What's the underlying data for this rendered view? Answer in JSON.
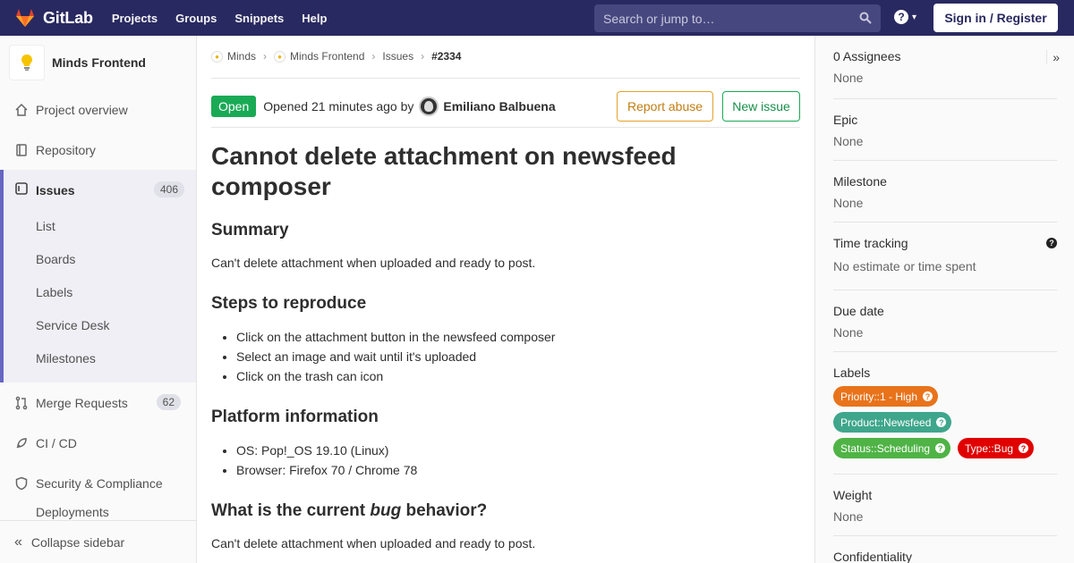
{
  "navbar": {
    "brand": "GitLab",
    "links": [
      "Projects",
      "Groups",
      "Snippets",
      "Help"
    ],
    "search_placeholder": "Search or jump to…",
    "signin_label": "Sign in / Register"
  },
  "sidebar": {
    "project_name": "Minds Frontend",
    "items": {
      "overview": "Project overview",
      "repository": "Repository",
      "issues": "Issues",
      "issues_count": "406",
      "merge_requests": "Merge Requests",
      "mr_count": "62",
      "cicd": "CI / CD",
      "security": "Security & Compliance",
      "deployments_partial": "Deployments"
    },
    "issues_sub": [
      "List",
      "Boards",
      "Labels",
      "Service Desk",
      "Milestones"
    ],
    "collapse_label": "Collapse sidebar"
  },
  "breadcrumb": {
    "group": "Minds",
    "project": "Minds Frontend",
    "section": "Issues",
    "current": "#2334"
  },
  "issue": {
    "status": "Open",
    "opened_text": "Opened 21 minutes ago by",
    "author": "Emiliano Balbuena",
    "report_label": "Report abuse",
    "new_issue_label": "New issue",
    "title": "Cannot delete attachment on newsfeed composer",
    "summary_heading": "Summary",
    "summary_text": "Can't delete attachment when uploaded and ready to post.",
    "steps_heading": "Steps to reproduce",
    "steps": [
      "Click on the attachment button in the newsfeed composer",
      "Select an image and wait until it's uploaded",
      "Click on the trash can icon"
    ],
    "platform_heading": "Platform information",
    "platform": [
      "OS: Pop!_OS 19.10 (Linux)",
      "Browser: Firefox 70 / Chrome 78"
    ],
    "current_heading_pre": "What is the current ",
    "current_heading_em": "bug",
    "current_heading_post": " behavior?",
    "current_text": "Can't delete attachment when uploaded and ready to post."
  },
  "right_sidebar": {
    "assignees_title": "0 Assignees",
    "assignees_value": "None",
    "epic_title": "Epic",
    "epic_value": "None",
    "milestone_title": "Milestone",
    "milestone_value": "None",
    "time_title": "Time tracking",
    "time_value": "No estimate or time spent",
    "due_title": "Due date",
    "due_value": "None",
    "labels_title": "Labels",
    "labels": [
      {
        "text": "Priority::1 - High",
        "color": "#e8731b"
      },
      {
        "text": "Product::Newsfeed",
        "color": "#3fa68c"
      },
      {
        "text": "Status::Scheduling",
        "color": "#4fb346"
      },
      {
        "text": "Type::Bug",
        "color": "#e00000"
      }
    ],
    "weight_title": "Weight",
    "weight_value": "None",
    "confidentiality_title": "Confidentiality"
  },
  "colors": {
    "navbar": "#292961",
    "accent": "#6666c4",
    "open_green": "#1aaa55",
    "report_orange": "#e2a229"
  }
}
